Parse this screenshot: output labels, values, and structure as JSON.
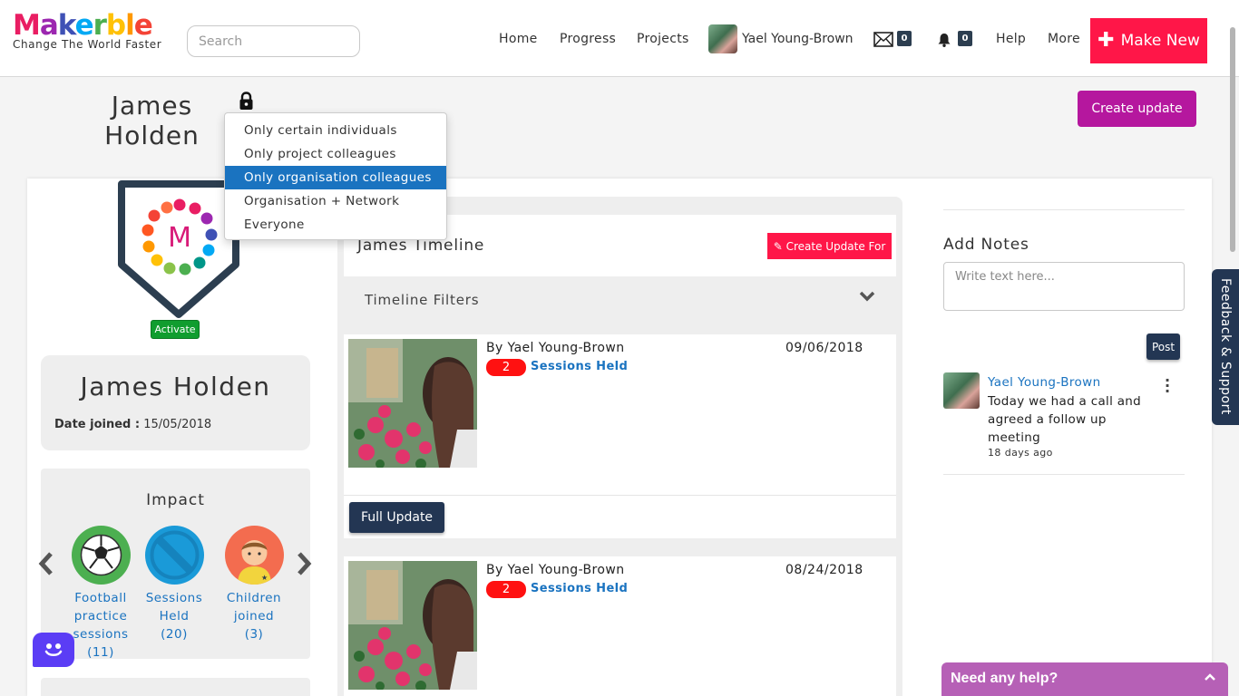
{
  "header": {
    "logo_text": "Makerble",
    "tagline": "Change The World Faster",
    "search_placeholder": "Search",
    "nav": [
      "Home",
      "Progress",
      "Projects"
    ],
    "user_name": "Yael Young-Brown",
    "mail_count": "0",
    "notification_count": "0",
    "help": "Help",
    "more": "More",
    "make_new": "Make New"
  },
  "profile": {
    "name_line1": "James",
    "name_line2": "Holden",
    "create_update": "Create update",
    "privacy_options": [
      "Only certain individuals",
      "Only project colleagues",
      "Only organisation colleagues",
      "Organisation + Network",
      "Everyone"
    ],
    "privacy_selected": "Only organisation colleagues"
  },
  "left": {
    "badge_letter": "M",
    "activate": "Activate",
    "full_name": "James Holden",
    "date_joined_label": "Date joined :",
    "date_joined": "15/05/2018",
    "impact_title": "Impact",
    "impact": [
      {
        "label_1": "Football",
        "label_2": "practice",
        "label_3": "sessions",
        "label_4": "(11)"
      },
      {
        "label_1": "Sessions",
        "label_2": "Held",
        "label_3": "(20)"
      },
      {
        "label_1": "Children",
        "label_2": "joined",
        "label_3": "(3)"
      }
    ]
  },
  "timeline": {
    "title": "James Timeline",
    "create_for": "Create Update For",
    "filters": "Timeline Filters",
    "posts": [
      {
        "by": "By Yael Young-Brown",
        "date": "09/06/2018",
        "count": "2",
        "tag": "Sessions Held"
      },
      {
        "by": "By Yael Young-Brown",
        "date": "08/24/2018",
        "count": "2",
        "tag": "Sessions Held"
      }
    ],
    "full_update": "Full Update"
  },
  "notes": {
    "title": "Add Notes",
    "placeholder": "Write text here...",
    "post": "Post",
    "items": [
      {
        "author": "Yael Young-Brown",
        "text": "Today we had a call and agreed a follow up meeting",
        "time": "18 days ago"
      }
    ]
  },
  "feedback": "Feedback & Support",
  "help_widget": "Need any help?",
  "colors": {
    "brand_red": "#ff1648",
    "brand_magenta": "#b5179e",
    "navy": "#233653",
    "link_blue": "#1a73c0",
    "help_purple": "#b660b6"
  }
}
